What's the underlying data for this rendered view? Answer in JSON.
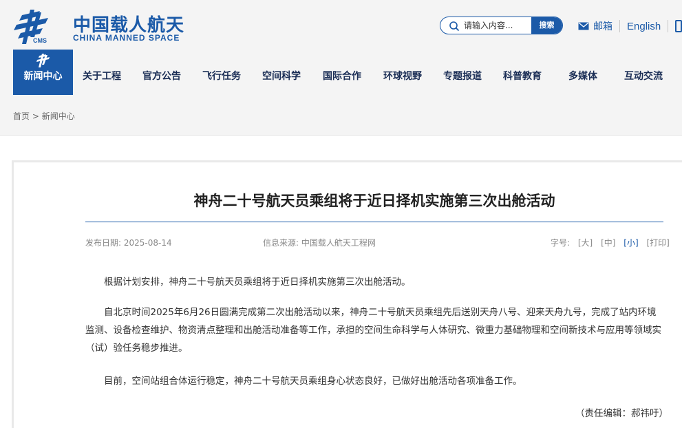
{
  "header": {
    "logo_cn": "中国载人航天",
    "logo_en": "CHINA MANNED SPACE",
    "logo_mark_text": "CMS",
    "search_placeholder": "请输入内容...",
    "search_button": "搜索",
    "mail_label": "邮箱",
    "english_label": "English"
  },
  "nav": {
    "items": [
      "新闻中心",
      "关于工程",
      "官方公告",
      "飞行任务",
      "空间科学",
      "国际合作",
      "环球视野",
      "专题报道",
      "科普教育",
      "多媒体",
      "互动交流"
    ]
  },
  "breadcrumb": {
    "home": "首页",
    "separator": ">",
    "current": "新闻中心"
  },
  "article": {
    "title": "神舟二十号航天员乘组将于近日择机实施第三次出舱活动",
    "date_text": "发布日期: 2025-08-14",
    "source_text": "信息来源: 中国载人航天工程网",
    "fontsize_label": "字号:",
    "fontsize_large": "[大]",
    "fontsize_medium": "[中]",
    "fontsize_small": "[小]",
    "print": "[打印]",
    "paragraphs": [
      "根据计划安排，神舟二十号航天员乘组将于近日择机实施第三次出舱活动。",
      "自北京时间2025年6月26日圆满完成第二次出舱活动以来，神舟二十号航天员乘组先后送别天舟八号、迎来天舟九号，完成了站内环境监测、设备检查维护、物资清点整理和出舱活动准备等工作，承担的空间生命科学与人体研究、微重力基础物理和空间新技术与应用等领域实（试）验任务稳步推进。",
      "目前，空间站组合体运行稳定，神舟二十号航天员乘组身心状态良好，已做好出舱活动各项准备工作。"
    ],
    "editor": "（责任编辑：郝祎吁）"
  },
  "colors": {
    "brand": "#1b5aa8",
    "nav_text": "#1a2d55"
  }
}
